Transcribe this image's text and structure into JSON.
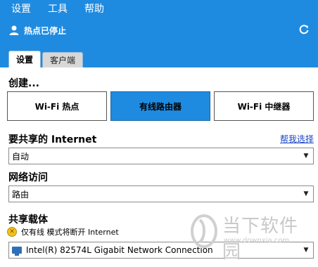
{
  "menu": [
    {
      "label": "设置"
    },
    {
      "label": "工具"
    },
    {
      "label": "帮助"
    }
  ],
  "status": {
    "text": "热点已停止"
  },
  "tabs": [
    {
      "label": "设置",
      "active": true
    },
    {
      "label": "客户端",
      "active": false
    }
  ],
  "create": {
    "label": "创建...",
    "modes": [
      {
        "label": "Wi-Fi 热点",
        "selected": false
      },
      {
        "label": "有线路由器",
        "selected": true
      },
      {
        "label": "Wi-Fi 中继器",
        "selected": false
      }
    ]
  },
  "internet": {
    "label": "要共享的 Internet",
    "help_link": "帮我选择",
    "value": "自动"
  },
  "network_access": {
    "label": "网络访问",
    "value": "路由"
  },
  "share_carrier": {
    "label": "共享载体",
    "warning": "仅有线 模式将断开 Internet",
    "value": "Intel(R) 82574L Gigabit Network Connection"
  },
  "watermark": {
    "brand": "当下软件园",
    "url": "www.downxia.com"
  },
  "colors": {
    "header": "#1f8be0",
    "selected_button": "#1f8be0",
    "link": "#1a45c2"
  }
}
